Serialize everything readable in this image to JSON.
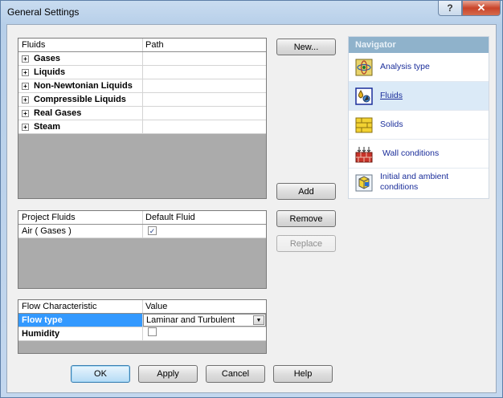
{
  "window": {
    "title": "General Settings",
    "help_label": "?",
    "close_label": "✕"
  },
  "fluids_table": {
    "headers": [
      "Fluids",
      "Path"
    ],
    "groups": [
      {
        "expander": "+",
        "label": "Gases",
        "path": ""
      },
      {
        "expander": "+",
        "label": "Liquids",
        "path": ""
      },
      {
        "expander": "+",
        "label": "Non-Newtonian Liquids",
        "path": ""
      },
      {
        "expander": "+",
        "label": "Compressible Liquids",
        "path": ""
      },
      {
        "expander": "+",
        "label": "Real Gases",
        "path": ""
      },
      {
        "expander": "+",
        "label": "Steam",
        "path": ""
      }
    ]
  },
  "project_fluids": {
    "headers": [
      "Project Fluids",
      "Default Fluid"
    ],
    "rows": [
      {
        "name": "Air ( Gases )",
        "default_checked": true,
        "check_glyph": "✓"
      }
    ]
  },
  "flow_table": {
    "headers": [
      "Flow Characteristic",
      "Value"
    ],
    "rows": [
      {
        "name": "Flow type",
        "value": "Laminar and Turbulent",
        "selected": true,
        "dropdown_glyph": "▼"
      },
      {
        "name": "Humidity",
        "value": "",
        "checked": false
      }
    ]
  },
  "buttons": {
    "new": "New...",
    "add": "Add",
    "remove": "Remove",
    "replace": "Replace",
    "ok": "OK",
    "apply": "Apply",
    "cancel": "Cancel",
    "help": "Help"
  },
  "navigator": {
    "title": "Navigator",
    "items": [
      {
        "label": "Analysis type",
        "icon": "analysis-type-icon"
      },
      {
        "label": "Fluids",
        "icon": "fluids-icon",
        "selected": true
      },
      {
        "label": "Solids",
        "icon": "solids-icon"
      },
      {
        "label": "Wall conditions",
        "icon": "wall-conditions-icon"
      },
      {
        "label": "Initial and ambient conditions",
        "icon": "initial-conditions-icon"
      }
    ]
  },
  "colors": {
    "selection": "#3399ff",
    "navigator_header": "#8fb2cb",
    "navigator_selected": "#dbeaf7",
    "link": "#1a2d9a"
  }
}
